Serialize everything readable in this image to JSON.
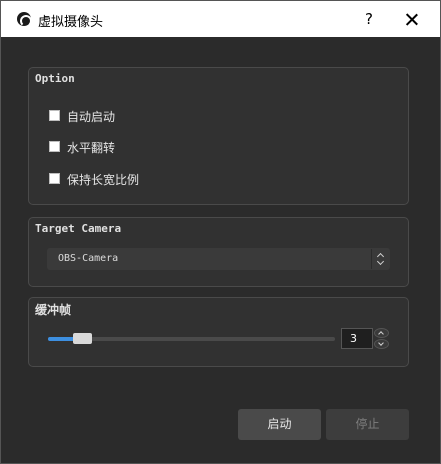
{
  "window": {
    "title": "虚拟摄像头",
    "help_label": "?"
  },
  "option_group": {
    "title": "Option",
    "checkboxes": [
      {
        "label": "自动启动",
        "checked": false
      },
      {
        "label": "水平翻转",
        "checked": false
      },
      {
        "label": "保持长宽比例",
        "checked": false
      }
    ]
  },
  "camera_group": {
    "title": "Target Camera",
    "selected": "OBS-Camera"
  },
  "buffer_group": {
    "title": "缓冲帧",
    "value": "3",
    "slider_fraction": 0.12
  },
  "buttons": {
    "start": "启动",
    "stop": "停止"
  },
  "colors": {
    "accent": "#3d8fe0",
    "background": "#2b2b2b",
    "titlebar": "#ffffff"
  }
}
